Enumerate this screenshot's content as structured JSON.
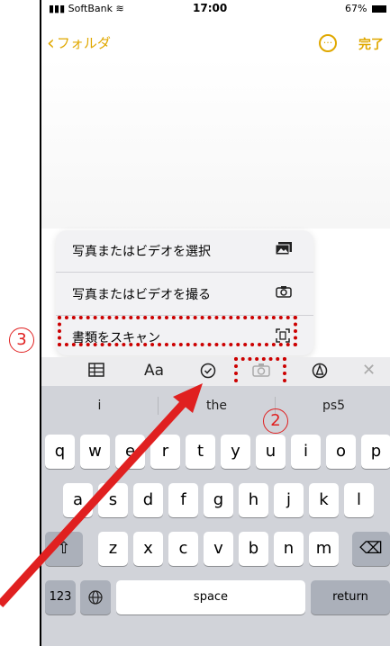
{
  "status": {
    "carrier": "SoftBank",
    "time": "17:00",
    "battery": "67%"
  },
  "nav": {
    "back_label": "フォルダ",
    "more_icon": "ellipsis-circle-icon",
    "done_label": "完了"
  },
  "menu": {
    "items": [
      {
        "label": "写真またはビデオを選択",
        "icon": "photo-library-icon"
      },
      {
        "label": "写真またはビデオを撮る",
        "icon": "camera-icon"
      },
      {
        "label": "書類をスキャン",
        "icon": "scan-document-icon"
      }
    ]
  },
  "toolbar": {
    "items": [
      "table-icon",
      "text-format-icon",
      "checklist-icon",
      "camera-icon",
      "markup-icon",
      "close-icon"
    ],
    "text_format_label": "Aa"
  },
  "keyboard": {
    "suggestions": [
      "i",
      "the",
      "ps5"
    ],
    "row1": [
      "q",
      "w",
      "e",
      "r",
      "t",
      "y",
      "u",
      "i",
      "o",
      "p"
    ],
    "row2": [
      "a",
      "s",
      "d",
      "f",
      "g",
      "h",
      "j",
      "k",
      "l"
    ],
    "row3": [
      "z",
      "x",
      "c",
      "v",
      "b",
      "n",
      "m"
    ],
    "numbers_key": "123",
    "space_key": "space",
    "return_key": "return"
  },
  "annotations": {
    "step2": "2",
    "step3": "3",
    "accent_color": "#e02020"
  },
  "colors": {
    "accent": "#e0a800",
    "keyboard_bg": "#d1d3d9"
  }
}
